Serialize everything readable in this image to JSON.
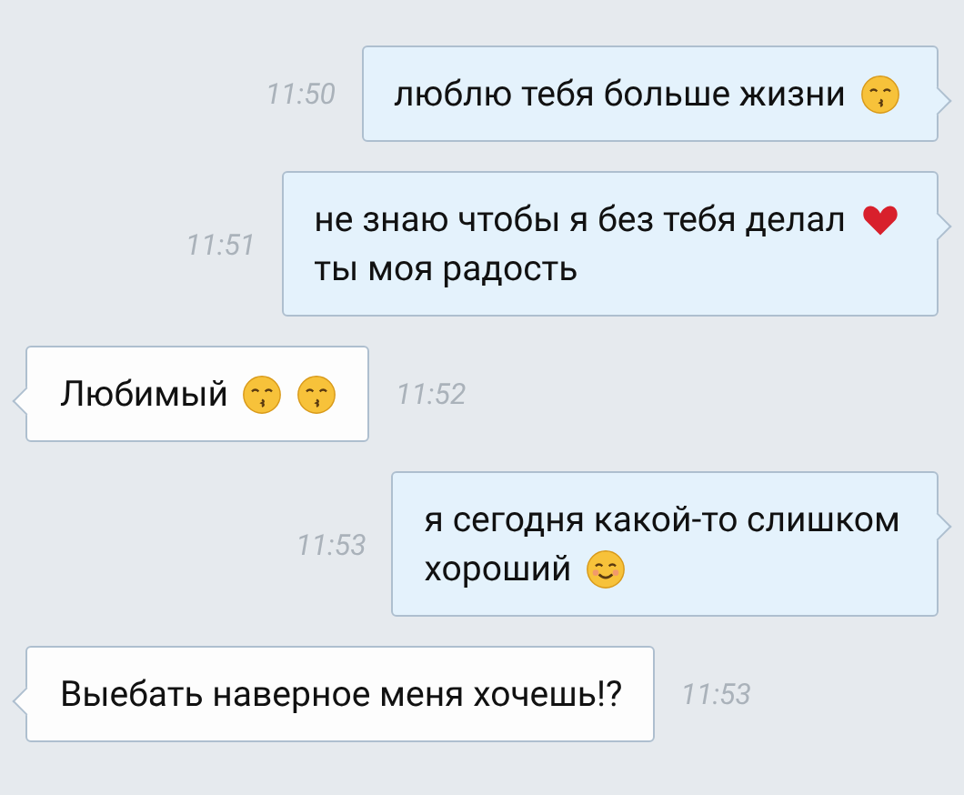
{
  "messages": [
    {
      "kind": "out",
      "time": "11:50",
      "lines": [
        {
          "text": "люблю тебя больше жизни",
          "icons": [
            {
              "kind": "kiss"
            }
          ]
        }
      ]
    },
    {
      "kind": "out",
      "time": "11:51",
      "lines": [
        {
          "text": "не знаю чтобы я без тебя делал",
          "icons": [
            {
              "kind": "heart"
            }
          ]
        },
        {
          "text": "ты моя радость"
        }
      ]
    },
    {
      "kind": "in",
      "time": "11:52",
      "lines": [
        {
          "text": "Любимый",
          "icons": [
            {
              "kind": "kiss"
            },
            {
              "kind": "kiss"
            }
          ]
        }
      ]
    },
    {
      "kind": "out",
      "time": "11:53",
      "lines": [
        {
          "text": "я сегодня какой-то слишком"
        },
        {
          "text": "хороший",
          "icons": [
            {
              "kind": "smile"
            }
          ]
        }
      ]
    },
    {
      "kind": "in",
      "time": "11:53",
      "lines": [
        {
          "text": "Выебать наверное меня хочешь!?"
        }
      ]
    }
  ]
}
